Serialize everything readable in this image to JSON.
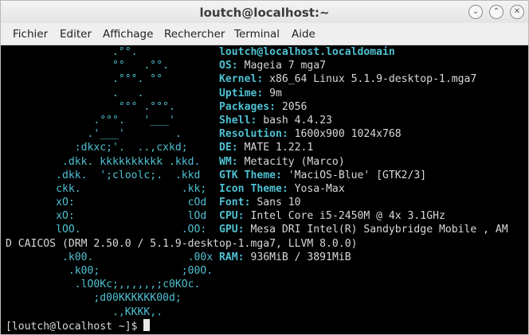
{
  "window": {
    "title": "loutch@localhost:~",
    "controls": [
      "minimize-icon",
      "maximize-icon",
      "close-icon"
    ]
  },
  "menubar": {
    "items": [
      "Fichier",
      "Editer",
      "Affichage",
      "Rechercher",
      "Terminal",
      "Aide"
    ]
  },
  "terminal": {
    "lines": [
      {
        "art": "                 .°°.",
        "info": [
          {
            "t": "loutch@localhost.localdomain",
            "c": "lbl"
          }
        ]
      },
      {
        "art": "                 °°   .°°.",
        "info": [
          {
            "t": "OS:",
            "c": "lbl"
          },
          {
            "t": " Mageia 7 mga7",
            "c": "val"
          }
        ]
      },
      {
        "art": "                 .°°°. °°",
        "info": [
          {
            "t": "Kernel:",
            "c": "lbl"
          },
          {
            "t": " x86_64 Linux 5.1.9-desktop-1.mga7",
            "c": "val"
          }
        ]
      },
      {
        "art": "                 .   .",
        "info": [
          {
            "t": "Uptime:",
            "c": "lbl"
          },
          {
            "t": " 9m",
            "c": "val"
          }
        ]
      },
      {
        "art": "                  °°° .°°°.",
        "info": [
          {
            "t": "Packages:",
            "c": "lbl"
          },
          {
            "t": " 2056",
            "c": "val"
          }
        ]
      },
      {
        "art": "              .°°°.   '___'",
        "info": [
          {
            "t": "Shell:",
            "c": "lbl"
          },
          {
            "t": " bash 4.4.23",
            "c": "val"
          }
        ]
      },
      {
        "art": "             .'___'        .",
        "info": [
          {
            "t": "Resolution:",
            "c": "lbl"
          },
          {
            "t": " 1600x900 1024x768",
            "c": "val"
          }
        ]
      },
      {
        "art": "           :dkxc;'.  ..,cxkd;",
        "info": [
          {
            "t": "DE:",
            "c": "lbl"
          },
          {
            "t": " MATE 1.22.1",
            "c": "val"
          }
        ]
      },
      {
        "art": "         .dkk. kkkkkkkkkk .kkd.",
        "info": [
          {
            "t": "WM:",
            "c": "lbl"
          },
          {
            "t": " Metacity (Marco)",
            "c": "val"
          }
        ]
      },
      {
        "art": "        .dkk.  ';cloolc;.  .kkd",
        "info": [
          {
            "t": "GTK Theme:",
            "c": "lbl"
          },
          {
            "t": " 'MaciOS-Blue' [GTK2/3]",
            "c": "val"
          }
        ]
      },
      {
        "art": "        ckk.                .kk;",
        "info": [
          {
            "t": "Icon Theme:",
            "c": "lbl"
          },
          {
            "t": " Yosa-Max",
            "c": "val"
          }
        ]
      },
      {
        "art": "        xO:                  cOd",
        "info": [
          {
            "t": "Font:",
            "c": "lbl"
          },
          {
            "t": " Sans 10",
            "c": "val"
          }
        ]
      },
      {
        "art": "        xO:                  lOd",
        "info": [
          {
            "t": "CPU:",
            "c": "lbl"
          },
          {
            "t": " Intel Core i5-2450M @ 4x 3.1GHz",
            "c": "val"
          }
        ]
      },
      {
        "art": "        lOO.                .OO:",
        "info": [
          {
            "t": "GPU:",
            "c": "lbl"
          },
          {
            "t": " Mesa DRI Intel(R) Sandybridge Mobile , AM",
            "c": "val"
          }
        ]
      },
      {
        "art": "D CAICOS (DRM 2.50.0 / 5.1.9-desktop-1.mga7, LLVM 8.0.0)",
        "info": []
      },
      {
        "art": "         .k00.               .00x",
        "info": [
          {
            "t": "RAM:",
            "c": "lbl"
          },
          {
            "t": " 936MiB / 3891MiB",
            "c": "val"
          }
        ]
      },
      {
        "art": "          .k00;             ;00O.",
        "info": []
      },
      {
        "art": "           .lO0Kc;,,,,,,;c0KOc.",
        "info": []
      },
      {
        "art": "              ;d00KKKKKK00d;",
        "info": []
      },
      {
        "art": "                 .,KKKK,.",
        "info": []
      }
    ],
    "prompt": "[loutch@localhost ~]$ "
  }
}
